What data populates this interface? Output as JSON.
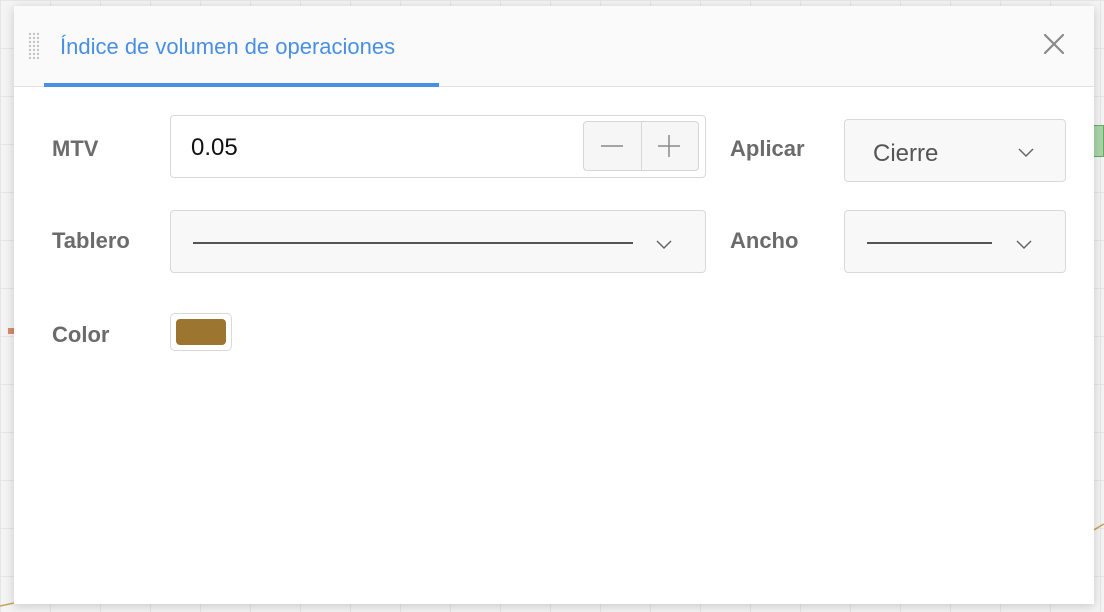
{
  "dialog": {
    "title": "Índice de volumen de operaciones"
  },
  "form": {
    "mtv": {
      "label": "MTV",
      "value": "0.05"
    },
    "aplicar": {
      "label": "Aplicar",
      "value": "Cierre"
    },
    "tablero": {
      "label": "Tablero"
    },
    "ancho": {
      "label": "Ancho"
    },
    "color": {
      "label": "Color",
      "value": "#9c7530"
    }
  },
  "colors": {
    "accent": "#4a90e2",
    "label": "#6b6b6b",
    "swatch": "#9c7530"
  },
  "icons": [
    "drag-handle-icon",
    "close-icon",
    "minus-icon",
    "plus-icon",
    "chevron-down-icon"
  ]
}
